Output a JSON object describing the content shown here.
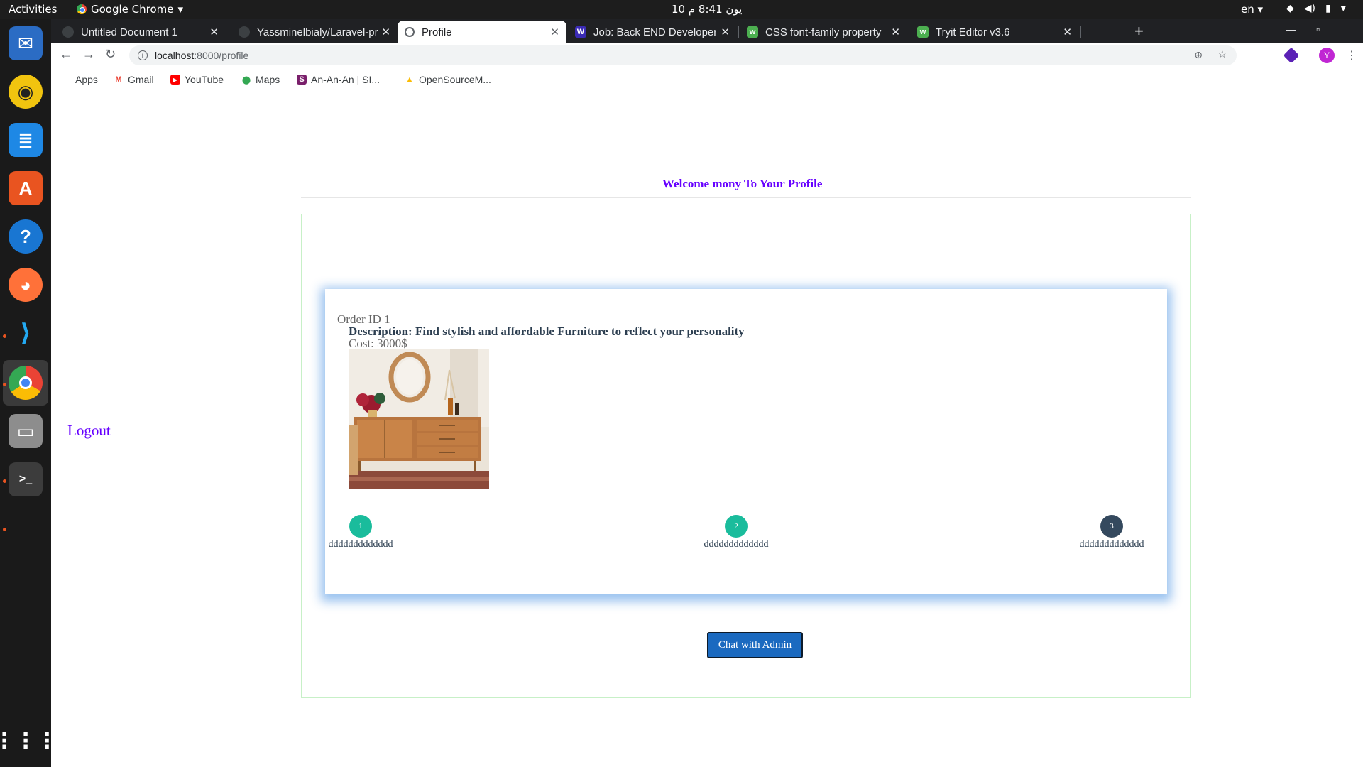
{
  "system_bar": {
    "activities": "Activities",
    "app_name": "Google Chrome",
    "clock": "10 يون 8:41 م",
    "language": "en"
  },
  "dock": {
    "apps": [
      "thunderbird-icon",
      "rhythmbox-icon",
      "writer-icon",
      "app-center-icon",
      "help-icon",
      "firefox-icon",
      "vscode-icon",
      "chrome-icon",
      "files-icon",
      "terminal-icon",
      "show-apps-icon"
    ]
  },
  "tabs": [
    {
      "title": "Untitled Document 1"
    },
    {
      "title": "Yassminelbialy/Laravel-pr"
    },
    {
      "title": "Profile"
    },
    {
      "title": "Job: Back END Developer"
    },
    {
      "title": "CSS font-family property"
    },
    {
      "title": "Tryit Editor v3.6"
    }
  ],
  "tab_close": "✕",
  "new_tab": "+",
  "address": {
    "host": "localhost",
    "path": ":8000/profile"
  },
  "bookmarks": [
    {
      "label": "Apps"
    },
    {
      "label": "Gmail"
    },
    {
      "label": "YouTube"
    },
    {
      "label": "Maps"
    },
    {
      "label": "An-An-An | SI..."
    },
    {
      "label": "OpenSourceM..."
    }
  ],
  "profile": {
    "welcome": "Welcome mony To Your Profile",
    "logout": "Logout",
    "avatar_letter": "Y"
  },
  "order": {
    "id_text": "Order ID 1",
    "description": "Description: Find stylish and affordable Furniture to reflect your personality",
    "cost": "Cost: 3000$"
  },
  "steps": [
    {
      "number": "1",
      "label": "ddddddddddddd",
      "color": "#1abc9c"
    },
    {
      "number": "2",
      "label": "ddddddddddddd",
      "color": "#1abc9c"
    },
    {
      "number": "3",
      "label": "ddddddddddddd",
      "color": "#34495e"
    }
  ],
  "chat_button": "Chat with Admin"
}
